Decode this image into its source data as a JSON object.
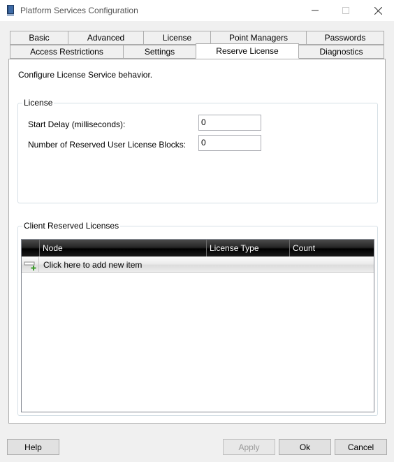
{
  "window": {
    "title": "Platform Services Configuration"
  },
  "tabs": {
    "row1": [
      {
        "label": "Basic"
      },
      {
        "label": "Advanced"
      },
      {
        "label": "License"
      },
      {
        "label": "Point Managers"
      },
      {
        "label": "Passwords"
      }
    ],
    "row2": [
      {
        "label": "Access Restrictions"
      },
      {
        "label": "Settings"
      },
      {
        "label": "Reserve License",
        "selected": true
      },
      {
        "label": "Diagnostics"
      }
    ]
  },
  "panel": {
    "description": "Configure License Service behavior.",
    "license_group": {
      "title": "License",
      "start_delay": {
        "label": "Start Delay (milliseconds):",
        "value": "0"
      },
      "reserved_blocks": {
        "label": "Number of Reserved User License Blocks:",
        "value": "0"
      }
    },
    "client_group": {
      "title": "Client Reserved Licenses",
      "columns": [
        "Node",
        "License Type",
        "Count"
      ],
      "new_row_text": "Click here to add new item",
      "rows": []
    }
  },
  "buttons": {
    "help": "Help",
    "apply": "Apply",
    "ok": "Ok",
    "cancel": "Cancel"
  },
  "colors": {
    "grid_header": "#1a1a1a",
    "new_item_plus": "#3a9a2a"
  }
}
